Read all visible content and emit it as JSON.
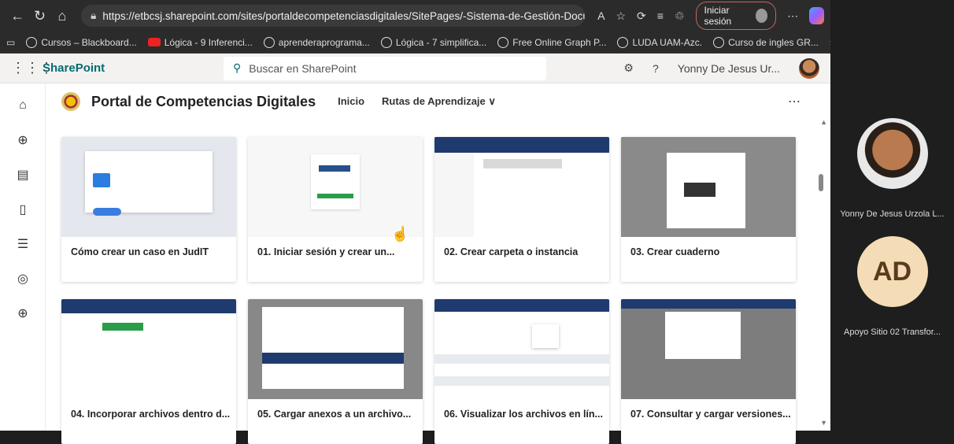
{
  "browser": {
    "url": "https://etbcsj.sharepoint.com/sites/portaldecompetenciasdigitales/SitePages/-Sistema-de-Gestión-Docume...",
    "signin_label": "Iniciar sesión",
    "favorites": [
      {
        "label": "Cursos – Blackboard...",
        "icon": "globe"
      },
      {
        "label": "Lógica - 9 Inferenci...",
        "icon": "youtube"
      },
      {
        "label": "aprenderaprograma...",
        "icon": "globe"
      },
      {
        "label": "Lógica - 7 simplifica...",
        "icon": "globe"
      },
      {
        "label": "Free Online Graph P...",
        "icon": "globe"
      },
      {
        "label": "LUDA UAM-Azc.",
        "icon": "globe"
      },
      {
        "label": "Curso de ingles GR...",
        "icon": "globe"
      }
    ]
  },
  "sharepoint": {
    "brand": "SharePoint",
    "search_placeholder": "Buscar en SharePoint",
    "user_name": "Yonny De Jesus Ur...",
    "help": "?"
  },
  "site": {
    "title": "Portal de Competencias Digitales",
    "nav": [
      "Inicio",
      "Rutas de Aprendizaje"
    ]
  },
  "cards": [
    {
      "title": "Cómo crear un caso en JudIT"
    },
    {
      "title": "01. Iniciar sesión y crear un..."
    },
    {
      "title": "02. Crear carpeta o instancia"
    },
    {
      "title": "03. Crear cuaderno"
    },
    {
      "title": "04. Incorporar archivos dentro d..."
    },
    {
      "title": "05. Cargar anexos a un archivo..."
    },
    {
      "title": "06. Visualizar los archivos en lín..."
    },
    {
      "title": "07. Consultar y cargar versiones..."
    }
  ],
  "video": {
    "participants": [
      {
        "name": "Yonny De Jesus Urzola L...",
        "initials": ""
      },
      {
        "name": "Apoyo Sitio 02 Transfor...",
        "initials": "AD"
      }
    ]
  },
  "colors": {
    "brand": "#036c70",
    "header_dark": "#1f3a6e"
  }
}
